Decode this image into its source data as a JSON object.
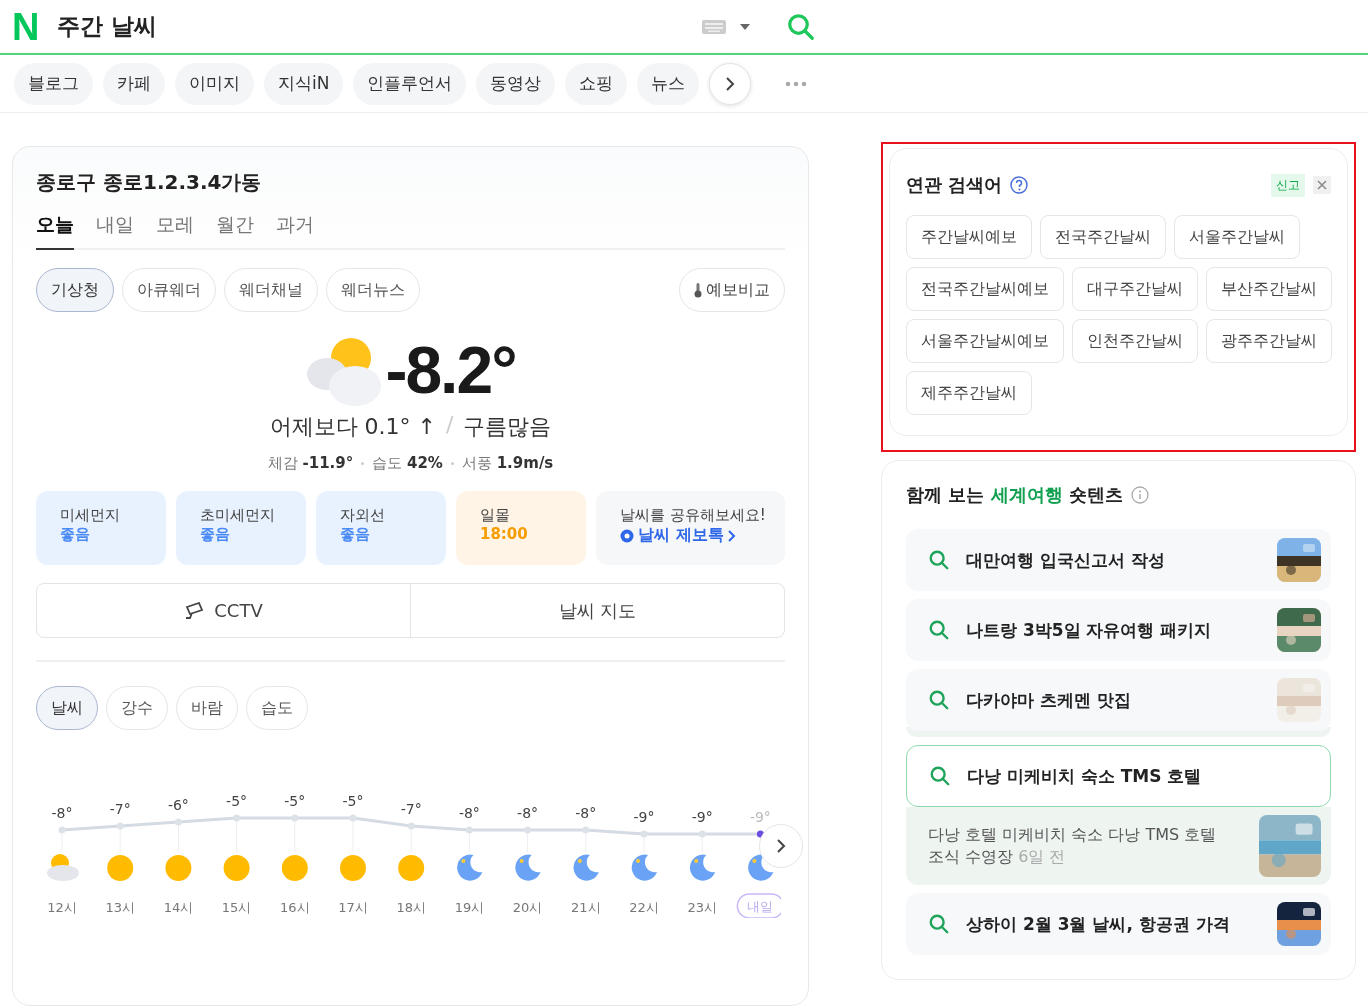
{
  "header": {
    "logo": "N",
    "title": "주간 날씨"
  },
  "verticals": [
    {
      "label": "블로그",
      "selected": false
    },
    {
      "label": "카페",
      "selected": false
    },
    {
      "label": "이미지",
      "selected": false
    },
    {
      "label": "지식iN",
      "selected": false
    },
    {
      "label": "인플루언서",
      "selected": false
    },
    {
      "label": "동영상",
      "selected": false
    },
    {
      "label": "쇼핑",
      "selected": false
    },
    {
      "label": "뉴스",
      "selected": false
    }
  ],
  "weather": {
    "location": "종로구 종로1.2.3.4가동",
    "day_tabs": [
      {
        "label": "오늘",
        "selected": true
      },
      {
        "label": "내일",
        "selected": false
      },
      {
        "label": "모레",
        "selected": false
      },
      {
        "label": "월간",
        "selected": false
      },
      {
        "label": "과거",
        "selected": false
      }
    ],
    "sources": [
      {
        "label": "기상청",
        "selected": true
      },
      {
        "label": "아큐웨더",
        "selected": false
      },
      {
        "label": "웨더채널",
        "selected": false
      },
      {
        "label": "웨더뉴스",
        "selected": false
      }
    ],
    "compare_button": "예보비교",
    "current": {
      "temp": "-8.2°",
      "change": "어제보다 0.1° ↑",
      "separator": "/",
      "condition": "구름많음",
      "details": [
        {
          "label": "체감",
          "value": "-11.9°"
        },
        {
          "label": "습도",
          "value": "42%"
        },
        {
          "label": "서풍",
          "value": "1.9m/s"
        }
      ]
    },
    "indicators": [
      {
        "label": "미세먼지",
        "value": "좋음",
        "kind": "air"
      },
      {
        "label": "초미세먼지",
        "value": "좋음",
        "kind": "air"
      },
      {
        "label": "자외선",
        "value": "좋음",
        "kind": "air"
      },
      {
        "label": "일몰",
        "value": "18:00",
        "kind": "sun"
      }
    ],
    "share": {
      "text": "날씨를 공유해보세요!",
      "link": "날씨 제보톡"
    },
    "links": [
      {
        "label": "CCTV",
        "kind": "camera"
      },
      {
        "label": "날씨 지도",
        "kind": "plain"
      }
    ],
    "chart_tabs": [
      {
        "label": "날씨",
        "selected": true
      },
      {
        "label": "강수",
        "selected": false
      },
      {
        "label": "바람",
        "selected": false
      },
      {
        "label": "습도",
        "selected": false
      }
    ],
    "hourly_icons": [
      {
        "kind": "partly"
      },
      {
        "kind": "sun"
      },
      {
        "kind": "sun"
      },
      {
        "kind": "sun"
      },
      {
        "kind": "sun"
      },
      {
        "kind": "sun"
      },
      {
        "kind": "sun"
      },
      {
        "kind": "moon"
      },
      {
        "kind": "moon"
      },
      {
        "kind": "moon"
      },
      {
        "kind": "moon"
      },
      {
        "kind": "moon"
      },
      {
        "kind": "moon"
      }
    ],
    "chart_data": {
      "type": "line",
      "grid": true,
      "marker": true,
      "categories": [
        "12시",
        "13시",
        "14시",
        "15시",
        "16시",
        "17시",
        "18시",
        "19시",
        "20시",
        "21시",
        "22시",
        "23시",
        "내일"
      ],
      "values": [
        -8,
        -7,
        -6,
        -5,
        -5,
        -5,
        -7,
        -8,
        -8,
        -8,
        -9,
        -9,
        -9
      ],
      "value_labels": [
        "-8°",
        "-7°",
        "-6°",
        "-5°",
        "-5°",
        "-5°",
        "-7°",
        "-8°",
        "-8°",
        "-8°",
        "-9°",
        "-9°",
        "-9°"
      ]
    }
  },
  "related": {
    "title": "연관 검색어",
    "report": "신고",
    "keywords": [
      "주간날씨예보",
      "전국주간날씨",
      "서울주간날씨",
      "전국주간날씨예보",
      "대구주간날씨",
      "부산주간날씨",
      "서울주간날씨예보",
      "인천주간날씨",
      "광주주간날씨",
      "제주주간날씨"
    ]
  },
  "shorts": {
    "title_before": "함께 보는",
    "highlight": "세계여행",
    "title_after": "숏텐츠",
    "items": [
      {
        "kind": "plain",
        "query": "대만여행 입국신고서 작성"
      },
      {
        "kind": "plain",
        "query": "나트랑 3박5일 자유여행 패키지"
      },
      {
        "kind": "stacked",
        "query": "다카야마 츠케멘 맛집"
      },
      {
        "kind": "expanded",
        "query": "다낭 미케비치 숙소 TMS 호텔",
        "snippet": "다낭 호텔 미케비치 숙소 다낭 TMS 호텔 조식 수영장",
        "age": "6일 전"
      },
      {
        "kind": "plain",
        "query": "상하이 2월 3월 날씨, 항공권 가격"
      }
    ]
  }
}
